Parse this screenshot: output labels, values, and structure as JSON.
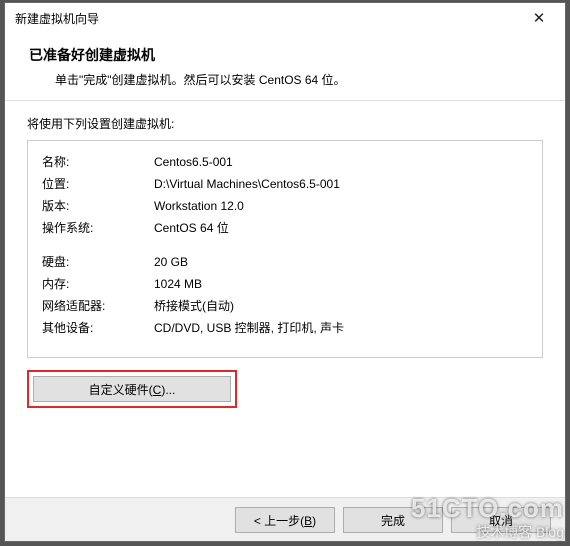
{
  "titlebar": {
    "title": "新建虚拟机向导"
  },
  "header": {
    "heading": "已准备好创建虚拟机",
    "sub": "单击\"完成\"创建虚拟机。然后可以安装 CentOS 64 位。"
  },
  "body": {
    "intro": "将使用下列设置创建虚拟机:",
    "rows1": [
      {
        "k": "名称:",
        "v": "Centos6.5-001"
      },
      {
        "k": "位置:",
        "v": "D:\\Virtual Machines\\Centos6.5-001"
      },
      {
        "k": "版本:",
        "v": "Workstation 12.0"
      },
      {
        "k": "操作系统:",
        "v": "CentOS 64 位"
      }
    ],
    "rows2": [
      {
        "k": "硬盘:",
        "v": "20 GB"
      },
      {
        "k": "内存:",
        "v": "1024 MB"
      },
      {
        "k": "网络适配器:",
        "v": "桥接模式(自动)"
      },
      {
        "k": "其他设备:",
        "v": "CD/DVD, USB 控制器, 打印机, 声卡"
      }
    ],
    "customize_pre": "自定义硬件(",
    "customize_key": "C",
    "customize_post": ")..."
  },
  "footer": {
    "back_pre": "< 上一步(",
    "back_key": "B",
    "back_post": ")",
    "finish": "完成",
    "cancel": "取消"
  },
  "watermark": {
    "l1": "51CTO.com",
    "l2": "技术博客 Blog"
  },
  "colors": {
    "highlight_border": "#d82c2c"
  }
}
